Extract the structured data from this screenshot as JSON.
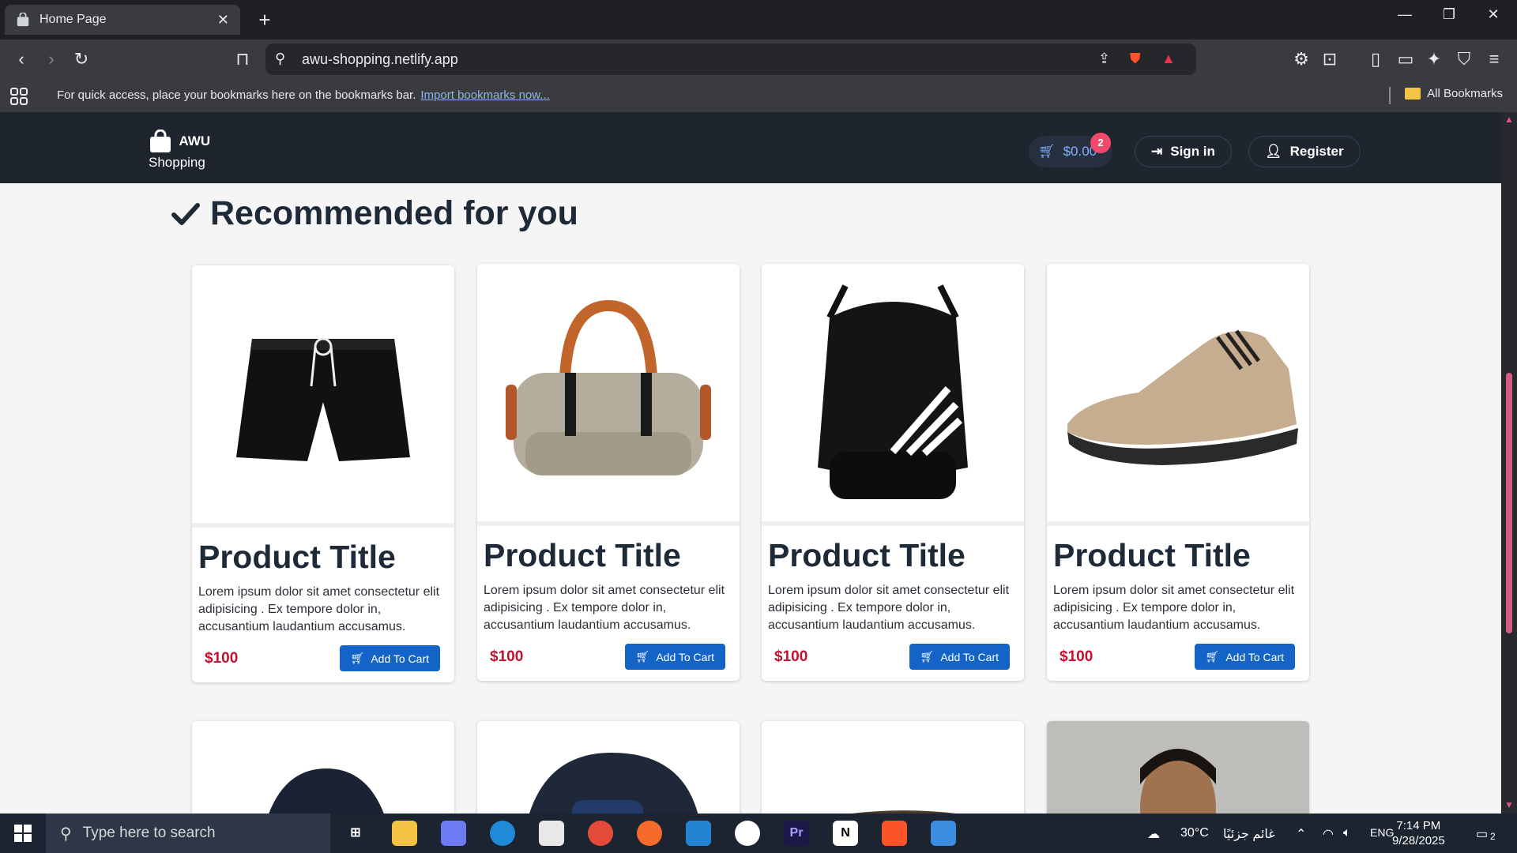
{
  "browser": {
    "tab_title": "Home Page",
    "url": "awu-shopping.netlify.app",
    "bookmarks_message": "For quick access, place your bookmarks here on the bookmarks bar.",
    "bookmarks_link": "Import bookmarks now...",
    "all_bookmarks": "All Bookmarks"
  },
  "site": {
    "logo_top": "AWU",
    "logo_bottom": "Shopping",
    "cart_total": "$0.00",
    "cart_count": "2",
    "sign_in": "Sign in",
    "register": "Register"
  },
  "section": {
    "title": "Recommended for you"
  },
  "products": [
    {
      "title": "Product Title",
      "description": "Lorem ipsum dolor sit amet consectetur elit adipisicing . Ex tempore dolor in, accusantium laudantium accusamus.",
      "price": "$100",
      "button": "Add To Cart",
      "image": "black-shorts"
    },
    {
      "title": "Product Title",
      "description": "Lorem ipsum dolor sit amet consectetur elit adipisicing . Ex tempore dolor in, accusantium laudantium accusamus.",
      "price": "$100",
      "button": "Add To Cart",
      "image": "duffel-bag"
    },
    {
      "title": "Product Title",
      "description": "Lorem ipsum dolor sit amet consectetur elit adipisicing . Ex tempore dolor in, accusantium laudantium accusamus.",
      "price": "$100",
      "button": "Add To Cart",
      "image": "drawstring-backpack"
    },
    {
      "title": "Product Title",
      "description": "Lorem ipsum dolor sit amet consectetur elit adipisicing . Ex tempore dolor in, accusantium laudantium accusamus.",
      "price": "$100",
      "button": "Add To Cart",
      "image": "knit-sneaker"
    }
  ],
  "taskbar": {
    "search_placeholder": "Type here to search",
    "weather": "30°C",
    "weather_text": "غائم جزئيًا",
    "language": "ENG",
    "time": "7:14 PM",
    "date": "9/28/2025",
    "notifications": "2"
  },
  "colors": {
    "nav_bg": "#1f252e",
    "accent_blue": "#1464c8",
    "price_red": "#c2102f",
    "badge_pink": "#f0496b"
  }
}
